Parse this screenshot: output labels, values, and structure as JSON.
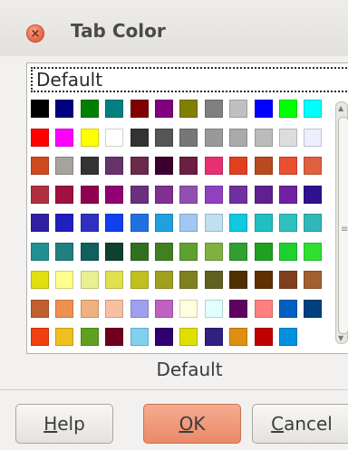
{
  "window": {
    "title": "Tab Color",
    "close_glyph": "×"
  },
  "palette": {
    "name": "Default",
    "selected_color_name": "Default",
    "colors": [
      [
        "#000000",
        "#000080",
        "#008000",
        "#008080",
        "#800000",
        "#800080",
        "#808000",
        "#808080",
        "#c0c0c0",
        "#0000ff",
        "#00ff00",
        "#00ffff"
      ],
      [
        "#ff0000",
        "#ff00ff",
        "#ffff00",
        "#ffffff",
        "#333333",
        "#555555",
        "#777777",
        "#999999",
        "#aaaaaa",
        "#bbbbbb",
        "#dddddd",
        "#eeeeff"
      ],
      [
        "#d04a20",
        "#a6a29c",
        "#333333",
        "#66336a",
        "#6a2a4a",
        "#3a0030",
        "#6a2040",
        "#e83070",
        "#e04020",
        "#b84a20",
        "#e85030",
        "#e06040"
      ],
      [
        "#b03040",
        "#a01040",
        "#900050",
        "#900070",
        "#6a3080",
        "#803090",
        "#9050b0",
        "#9040c0",
        "#7030a0",
        "#602090",
        "#7020a0",
        "#301090"
      ],
      [
        "#3020a0",
        "#2020c0",
        "#3030c0",
        "#1040f0",
        "#2070e0",
        "#20a0e0",
        "#a0c8f0",
        "#c0e0f0",
        "#10c8e0",
        "#20c0c0",
        "#30c0c0",
        "#30b8b8"
      ],
      [
        "#209090",
        "#208080",
        "#106060",
        "#104030",
        "#307020",
        "#408020",
        "#60a030",
        "#80b040",
        "#30a030",
        "#20a020",
        "#20d030",
        "#30e030"
      ],
      [
        "#e0e010",
        "#ffff90",
        "#e8f090",
        "#e0e050",
        "#c0c020",
        "#a0a020",
        "#808020",
        "#606020",
        "#503000",
        "#603000",
        "#804020",
        "#a06030"
      ],
      [
        "#c06030",
        "#f09050",
        "#f0b080",
        "#f8c0a0",
        "#a0a0f0",
        "#c060c0",
        "#ffffe0",
        "#e0ffff",
        "#600060",
        "#ff8080",
        "#0060c0",
        "#004080"
      ],
      [
        "#f04010",
        "#f0c020",
        "#60a020",
        "#700020",
        "#80d0f0",
        "#300070",
        "#e0e000",
        "#302080",
        "#e09010",
        "#c00000",
        "#0090e0",
        null
      ]
    ]
  },
  "buttons": {
    "help": {
      "mnemonic": "H",
      "rest": "elp"
    },
    "ok": {
      "mnemonic": "O",
      "rest": "K"
    },
    "cancel": {
      "mnemonic": "C",
      "rest": "ancel"
    }
  }
}
